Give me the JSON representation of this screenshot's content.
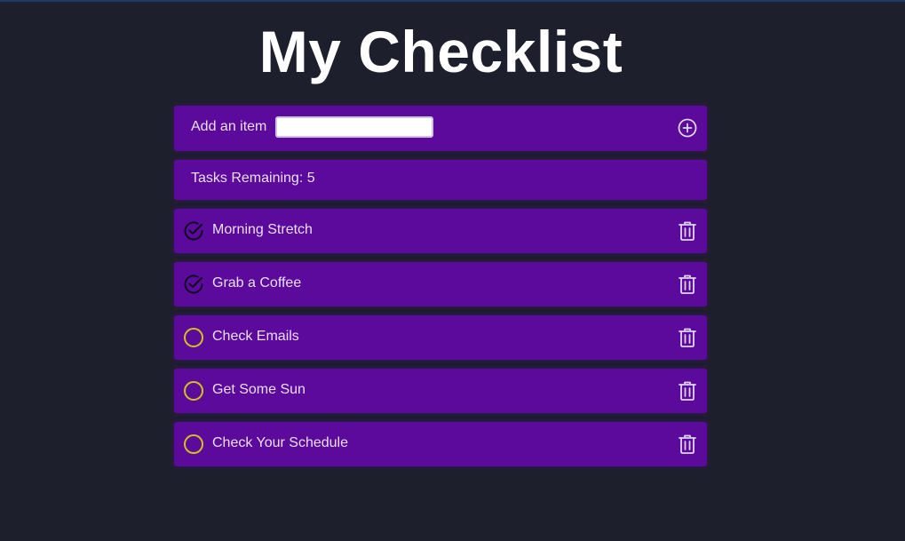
{
  "page": {
    "title": "My Checklist"
  },
  "add_item": {
    "label": "Add an item",
    "input_value": "",
    "input_placeholder": "",
    "add_icon": "plus-circle-icon"
  },
  "status": {
    "remaining_text": "Tasks Remaining: 5"
  },
  "tasks": [
    {
      "label": "Morning Stretch",
      "completed": true
    },
    {
      "label": "Grab a Coffee",
      "completed": true
    },
    {
      "label": "Check Emails",
      "completed": false
    },
    {
      "label": "Get Some Sun",
      "completed": false
    },
    {
      "label": "Check Your Schedule",
      "completed": false
    }
  ],
  "icons": {
    "completed": "check-circle-icon",
    "incomplete": "empty-circle-icon",
    "delete": "trash-icon"
  },
  "colors": {
    "background": "#1e1f2d",
    "panel": "#5b0a9c",
    "title": "#ffffff",
    "text": "#eadff5",
    "incomplete_circle": "#d4c21a",
    "completed_check": "#0d0520",
    "icon_light": "#e0d5ee"
  }
}
